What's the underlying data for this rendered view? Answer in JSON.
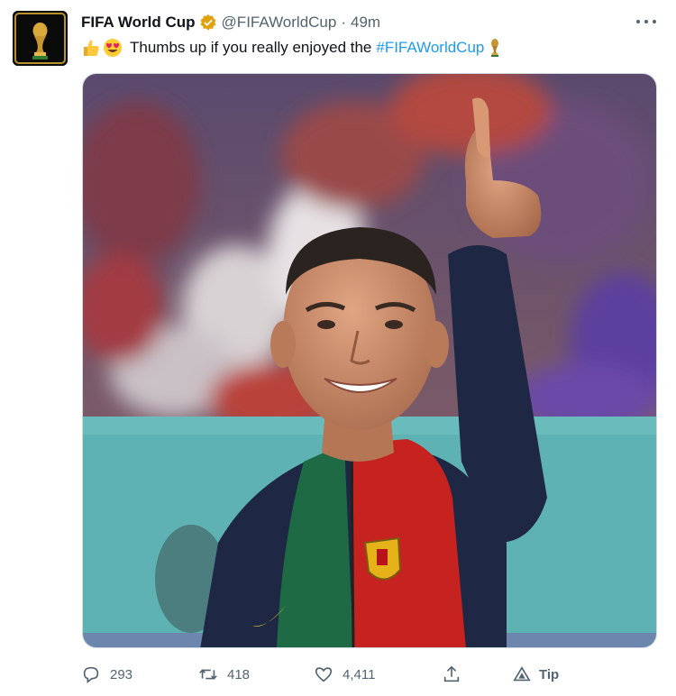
{
  "tweet": {
    "author_name": "FIFA World Cup",
    "handle": "@FIFAWorldCup",
    "separator": "·",
    "time": "49m",
    "text_main": "Thumbs up if you really enjoyed the",
    "hashtag": "#FIFAWorldCup",
    "verified_color": "#e2a10a",
    "hashtag_color": "#1d9bf0"
  },
  "actions": {
    "replies": "293",
    "retweets": "418",
    "likes": "4,411",
    "tip_label": "Tip"
  },
  "icons": {
    "verified": "gold-verified-badge",
    "emoji_1": "thumbs-up-emoji",
    "emoji_2": "heart-eyes-emoji",
    "emoji_3": "trophy-emoji",
    "reply": "reply-icon",
    "retweet": "retweet-icon",
    "like": "heart-icon",
    "share": "share-icon",
    "tip": "tip-icon",
    "more": "more-icon"
  }
}
